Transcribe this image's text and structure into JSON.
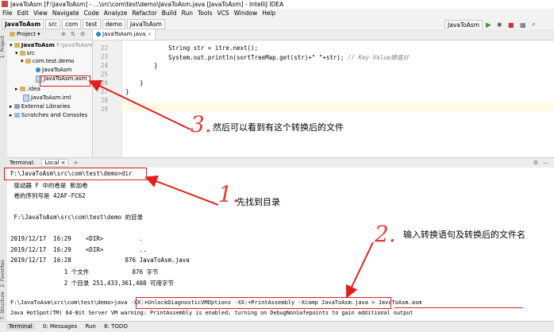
{
  "window": {
    "title": "JavaToAsm [F:\\JavaToAsm] - ...\\src\\com\\test\\demo\\JavaToAsm.java [JavaToAsm] - IntelliJ IDEA"
  },
  "menu": [
    "File",
    "Edit",
    "View",
    "Navigate",
    "Code",
    "Analyze",
    "Refactor",
    "Build",
    "Run",
    "Tools",
    "VCS",
    "Window",
    "Help"
  ],
  "breadcrumbs": [
    "JavaToAsm",
    "src",
    "com",
    "test",
    "demo",
    "JavaToAsm"
  ],
  "toolbar": {
    "run_config": "JavaToAsm"
  },
  "left_strip": {
    "project": "1: Project",
    "favorites": "2: Favorites",
    "structure": "7: Structure"
  },
  "project_panel": {
    "title": "Project",
    "tree": [
      {
        "label": "JavaToAsm",
        "extra": "F:\\JavaToAsm",
        "type": "folder"
      },
      {
        "label": "src",
        "type": "folder"
      },
      {
        "label": "com.test.demo",
        "type": "package"
      },
      {
        "label": "JavaToAsm",
        "type": "java"
      },
      {
        "label": "JavaToAsm.asm",
        "type": "asm"
      },
      {
        "label": ".idea",
        "type": "folder"
      },
      {
        "label": "JavaToAsm.iml",
        "type": "file"
      },
      {
        "label": "External Libraries",
        "type": "lib"
      },
      {
        "label": "Scratches and Consoles",
        "type": "scratch"
      }
    ]
  },
  "editor": {
    "tab": "JavaToAsm.java",
    "lines": [
      {
        "n": "22",
        "text": "            String str = itre.next();"
      },
      {
        "n": "23",
        "text": "            System.out.println(sortTreeMap.get(str)+\" \"+str); // Key-Value键值对"
      },
      {
        "n": "24",
        "text": "        }"
      },
      {
        "n": "25",
        "text": ""
      },
      {
        "n": "26",
        "text": "    }"
      },
      {
        "n": "27",
        "text": "}"
      },
      {
        "n": "28",
        "text": ""
      },
      {
        "n": "29",
        "text": ""
      }
    ]
  },
  "terminal": {
    "header": "Terminal:",
    "tab": "Local",
    "lines": [
      "F:\\JavaToAsm\\src\\com\\test\\demo>dir",
      " 驱动器 F 中的卷是 新加卷",
      " 卷的序列号是 42AF-FC62",
      "",
      " F:\\JavaToAsm\\src\\com\\test\\demo 的目录",
      "",
      "2019/12/17  16:29    <DIR>          .",
      "2019/12/17  16:29    <DIR>          ..",
      "2019/12/17  16:28               876 JavaToAsm.java",
      "               1 个文件            876 字节",
      "               2 个目录 251,433,361,408 可用字节",
      "",
      "F:\\JavaToAsm\\src\\com\\test\\demo>java -XX:+UnlockDiagnosticVMOptions -XX:+PrintAssembly -Xcomp JavaToAsm.java > JavaToAsm.asm",
      "Java HotSpot(TM) 64-Bit Server VM warning: PrintAssembly is enabled; turning on DebugNonSafepoints to gain additional output"
    ]
  },
  "statusbar": [
    "Terminal",
    "0: Messages",
    "Run",
    "6: TODO"
  ],
  "annotations": {
    "step1_num": "1.",
    "step1_text": "先找到目录",
    "step2_num": "2.",
    "step2_text": "输入转换语句及转换后的文件名",
    "step3_num": "3.",
    "step3_text": "然后可以看到有这个转换后的文件"
  },
  "colors": {
    "annotation_red": "#e02020",
    "comment": "#808080",
    "keyword": "#000080"
  }
}
